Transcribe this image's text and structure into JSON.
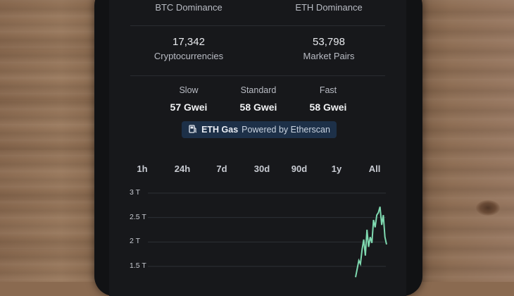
{
  "stats_top": {
    "btc_dominance_label": "BTC Dominance",
    "eth_dominance_label": "ETH Dominance"
  },
  "stats": {
    "cryptocurrencies_value": "17,342",
    "cryptocurrencies_label": "Cryptocurrencies",
    "market_pairs_value": "53,798",
    "market_pairs_label": "Market Pairs"
  },
  "gas": {
    "slow_label": "Slow",
    "slow_value": "57 Gwei",
    "standard_label": "Standard",
    "standard_value": "58 Gwei",
    "fast_label": "Fast",
    "fast_value": "58 Gwei",
    "badge_title": "ETH Gas",
    "badge_source": "Powered by Etherscan",
    "badge_icon": "gas-pump-icon"
  },
  "range_tabs": [
    "1h",
    "24h",
    "7d",
    "30d",
    "90d",
    "1y",
    "All"
  ],
  "colors": {
    "line": "#7fd9b0",
    "accent_badge": "#1d3048"
  },
  "chart_data": {
    "type": "line",
    "title": "",
    "xlabel": "",
    "ylabel": "",
    "y_ticks": [
      "3 T",
      "2.5 T",
      "2 T",
      "1.5 T"
    ],
    "ylim": [
      1.5,
      3
    ],
    "x": [
      0,
      1,
      2,
      3,
      4,
      5,
      6,
      7,
      8,
      9,
      10,
      11,
      12,
      13,
      14,
      15,
      16,
      17,
      18,
      19
    ],
    "series": [
      {
        "values": [
          1.28,
          1.45,
          1.62,
          1.55,
          1.85,
          2.05,
          1.72,
          2.25,
          1.9,
          2.1,
          1.98,
          2.45,
          2.3,
          2.55,
          2.6,
          2.72,
          2.35,
          2.55,
          2.1,
          1.95
        ]
      }
    ]
  }
}
